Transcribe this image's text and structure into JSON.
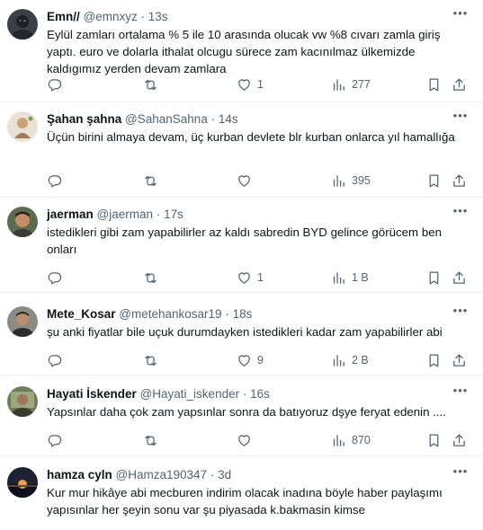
{
  "tweets": [
    {
      "name": "Emn//",
      "handle": "@emnxyz",
      "sep": "·",
      "time": "13s",
      "text": "Eylül zamları ortalama % 5 ile 10 arasında olucak vw %8 cıvarı zamla giriş yaptı. euro ve dolarla ithalat olcugu sürece zam kacınılmaz ülkemizde kaldıgımız yerden devam zamlara",
      "replies": "",
      "retweets": "",
      "likes": "1",
      "views": "277"
    },
    {
      "name": "Şahan şahna",
      "handle": "@SahanSahna",
      "sep": "·",
      "time": "14s",
      "text": "Üçün birini almaya devam, üç kurban devlete blr kurban onlarca yıl hamallığa",
      "replies": "",
      "retweets": "",
      "likes": "",
      "views": "395"
    },
    {
      "name": "jaerman",
      "handle": "@jaerman",
      "sep": "·",
      "time": "17s",
      "text": "istedikleri gibi zam yapabilirler az kaldı sabredin BYD gelince görücem ben onları",
      "replies": "",
      "retweets": "",
      "likes": "1",
      "views": "1 B"
    },
    {
      "name": "Mete_Kosar",
      "handle": "@metehankosar19",
      "sep": "·",
      "time": "18s",
      "text": "şu anki fiyatlar bile uçuk durumdayken istedikleri kadar zam yapabilirler abi",
      "replies": "",
      "retweets": "",
      "likes": "9",
      "views": "2 B"
    },
    {
      "name": "Hayati İskender",
      "handle": "@Hayati_iskender",
      "sep": "·",
      "time": "16s",
      "text": "Yapsınlar daha çok zam yapsınlar sonra da batıyoruz dşye feryat edenin ....",
      "replies": "",
      "retweets": "",
      "likes": "",
      "views": "870"
    },
    {
      "name": "hamza cyln",
      "handle": "@Hamza190347",
      "sep": "·",
      "time": "3d",
      "text": "Kur mur hikâye abi mecburen indirim olacak inadına böyle haber paylaşımı yapısınlar her şeyin sonu var şu piyasada k.bakmasin kimse",
      "replies": "",
      "retweets": "",
      "likes": "",
      "views": ""
    }
  ],
  "icons": {
    "reply": "reply-icon",
    "retweet": "retweet-icon",
    "like": "like-icon",
    "views": "views-icon",
    "bookmark": "bookmark-icon",
    "share": "share-icon",
    "more": "more-icon"
  },
  "colors": {
    "text": "#0f1419",
    "secondary": "#536471",
    "divider": "#eff3f4"
  }
}
